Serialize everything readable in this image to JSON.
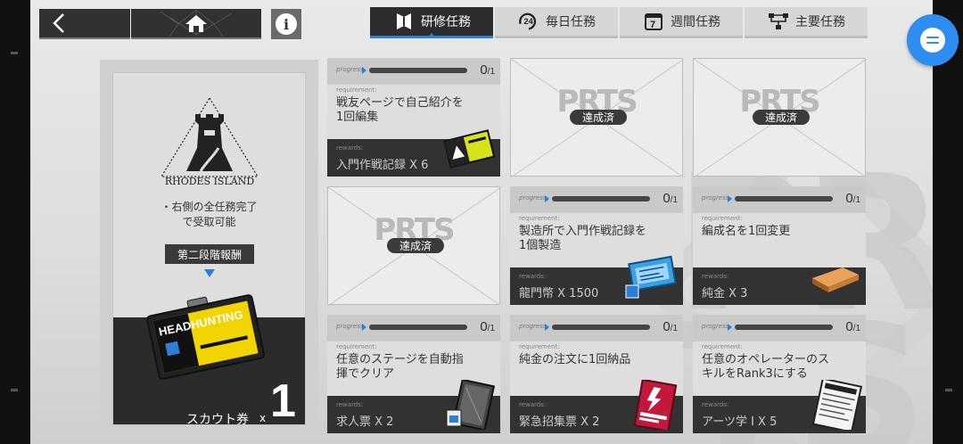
{
  "nav": {
    "back_icon": "chevron-left-icon",
    "home_icon": "home-icon",
    "info_label": "i"
  },
  "tabs": [
    {
      "label": "研修任務",
      "icon": "bookmark-icon",
      "active": true
    },
    {
      "label": "毎日任務",
      "icon": "24h-icon",
      "active": false
    },
    {
      "label": "週間任務",
      "icon": "calendar-7-icon",
      "active": false
    },
    {
      "label": "主要任務",
      "icon": "tree-icon",
      "active": false
    }
  ],
  "reward_panel": {
    "logo_text": "RHODES ISLAND",
    "condition_line1": "・右側の全任務完了",
    "condition_line2": "で受取可能",
    "stage_label": "第二段階報酬",
    "reward_name": "スカウト券",
    "reward_x": "x",
    "reward_count": "1",
    "card_text": "HEADHUNTING"
  },
  "tasks": [
    {
      "state": "active",
      "progress_label": "progress",
      "progress_current": "0",
      "progress_total": "1",
      "progress_fraction": 0,
      "requirement_label": "requirement:",
      "requirement": "戦友ページで自己紹介を1回編集",
      "rewards_label": "rewards:",
      "reward": "入門作戦記録 X 6",
      "reward_icon": "battle-record-icon"
    },
    {
      "state": "done",
      "badge": "達成済",
      "watermark": "PRTS"
    },
    {
      "state": "done",
      "badge": "達成済",
      "watermark": "PRTS"
    },
    {
      "state": "done",
      "badge": "達成済",
      "watermark": "PRTS"
    },
    {
      "state": "active",
      "progress_label": "progress",
      "progress_current": "0",
      "progress_total": "1",
      "progress_fraction": 0,
      "requirement_label": "requirement:",
      "requirement": "製造所で入門作戦記録を1個製造",
      "rewards_label": "rewards:",
      "reward": "龍門幣 X 1500",
      "reward_icon": "lmd-chip-icon"
    },
    {
      "state": "active",
      "progress_label": "progress",
      "progress_current": "0",
      "progress_total": "1",
      "progress_fraction": 0,
      "requirement_label": "requirement:",
      "requirement": "編成名を1回変更",
      "rewards_label": "rewards:",
      "reward": "純金 X 3",
      "reward_icon": "gold-bar-icon"
    },
    {
      "state": "active",
      "progress_label": "progress",
      "progress_current": "0",
      "progress_total": "1",
      "progress_fraction": 0,
      "requirement_label": "requirement:",
      "requirement": "任意のステージを自動指揮でクリア",
      "rewards_label": "rewards:",
      "reward": "求人票 X 2",
      "reward_icon": "recruit-permit-icon"
    },
    {
      "state": "active",
      "progress_label": "progress",
      "progress_current": "0",
      "progress_total": "1",
      "progress_fraction": 0,
      "requirement_label": "requirement:",
      "requirement": "純金の注文に1回納品",
      "rewards_label": "rewards:",
      "reward": "緊急招集票 X 2",
      "reward_icon": "expedited-plan-icon"
    },
    {
      "state": "active",
      "progress_label": "progress",
      "progress_current": "0",
      "progress_total": "1",
      "progress_fraction": 0,
      "requirement_label": "requirement:",
      "requirement": "任意のオペレーターのスキルをRank3にする",
      "rewards_label": "rewards:",
      "reward": "アーツ学 I X 5",
      "reward_icon": "skill-book-icon"
    }
  ],
  "colors": {
    "accent": "#2d7fd6",
    "dark": "#2d2d2d",
    "chat": "#2d8df0"
  }
}
